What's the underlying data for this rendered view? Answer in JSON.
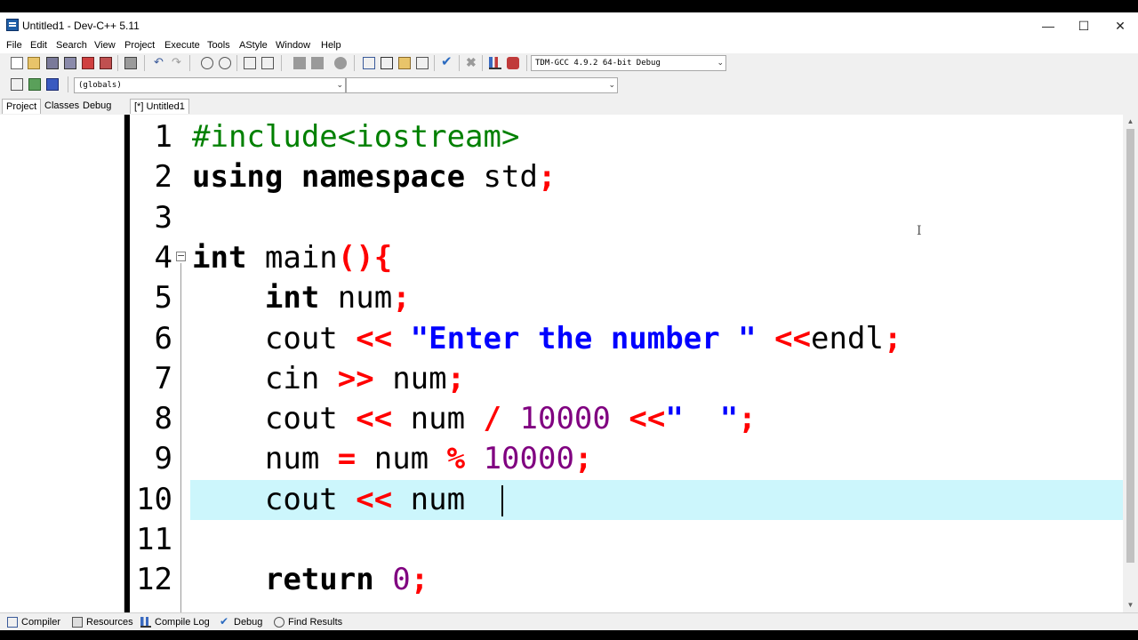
{
  "window": {
    "title": "Untitled1 - Dev-C++ 5.11",
    "minimize": "—",
    "maximize": "☐",
    "close": "✕"
  },
  "menu": [
    "File",
    "Edit",
    "Search",
    "View",
    "Project",
    "Execute",
    "Tools",
    "AStyle",
    "Window",
    "Help"
  ],
  "toolbar": {
    "compiler_select": "TDM-GCC 4.9.2 64-bit Debug",
    "scope_select": "(globals)",
    "symbol_select": ""
  },
  "left_tabs": [
    "Project",
    "Classes",
    "Debug"
  ],
  "editor": {
    "file_tab": "[*] Untitled1",
    "lines": [
      {
        "n": "1",
        "tokens": [
          {
            "t": "#include<iostream>",
            "c": "pre"
          }
        ]
      },
      {
        "n": "2",
        "tokens": [
          {
            "t": "using namespace",
            "c": "kw"
          },
          {
            "t": " std",
            "c": ""
          },
          {
            "t": ";",
            "c": "sym"
          }
        ]
      },
      {
        "n": "3",
        "tokens": []
      },
      {
        "n": "4",
        "tokens": [
          {
            "t": "int",
            "c": "kw"
          },
          {
            "t": " main",
            "c": ""
          },
          {
            "t": "(){",
            "c": "sym"
          }
        ]
      },
      {
        "n": "5",
        "tokens": [
          {
            "t": "    ",
            "c": ""
          },
          {
            "t": "int",
            "c": "kw"
          },
          {
            "t": " num",
            "c": ""
          },
          {
            "t": ";",
            "c": "sym"
          }
        ]
      },
      {
        "n": "6",
        "tokens": [
          {
            "t": "    cout ",
            "c": ""
          },
          {
            "t": "<<",
            "c": "sym"
          },
          {
            "t": " ",
            "c": ""
          },
          {
            "t": "\"Enter the number \"",
            "c": "str"
          },
          {
            "t": " ",
            "c": ""
          },
          {
            "t": "<<",
            "c": "sym"
          },
          {
            "t": "endl",
            "c": ""
          },
          {
            "t": ";",
            "c": "sym"
          }
        ]
      },
      {
        "n": "7",
        "tokens": [
          {
            "t": "    cin ",
            "c": ""
          },
          {
            "t": ">>",
            "c": "sym"
          },
          {
            "t": " num",
            "c": ""
          },
          {
            "t": ";",
            "c": "sym"
          }
        ]
      },
      {
        "n": "8",
        "tokens": [
          {
            "t": "    cout ",
            "c": ""
          },
          {
            "t": "<<",
            "c": "sym"
          },
          {
            "t": " num ",
            "c": ""
          },
          {
            "t": "/",
            "c": "sym"
          },
          {
            "t": " ",
            "c": ""
          },
          {
            "t": "10000",
            "c": "num"
          },
          {
            "t": " ",
            "c": ""
          },
          {
            "t": "<<",
            "c": "sym"
          },
          {
            "t": "\"  \"",
            "c": "str"
          },
          {
            "t": ";",
            "c": "sym"
          }
        ]
      },
      {
        "n": "9",
        "tokens": [
          {
            "t": "    num ",
            "c": ""
          },
          {
            "t": "=",
            "c": "sym"
          },
          {
            "t": " num ",
            "c": ""
          },
          {
            "t": "%",
            "c": "sym"
          },
          {
            "t": " ",
            "c": ""
          },
          {
            "t": "10000",
            "c": "num"
          },
          {
            "t": ";",
            "c": "sym"
          }
        ]
      },
      {
        "n": "10",
        "tokens": [
          {
            "t": "    cout ",
            "c": ""
          },
          {
            "t": "<<",
            "c": "sym"
          },
          {
            "t": " num ",
            "c": ""
          }
        ]
      },
      {
        "n": "11",
        "tokens": []
      },
      {
        "n": "12",
        "tokens": [
          {
            "t": "    ",
            "c": ""
          },
          {
            "t": "return",
            "c": "kw"
          },
          {
            "t": " ",
            "c": ""
          },
          {
            "t": "0",
            "c": "num"
          },
          {
            "t": ";",
            "c": "sym"
          }
        ]
      }
    ]
  },
  "bottom_tabs": [
    "Compiler",
    "Resources",
    "Compile Log",
    "Debug",
    "Find Results"
  ],
  "colors": {
    "current_line": "#ccf6fc",
    "preprocessor": "#008000",
    "symbol": "#ff0000",
    "string": "#0000ff",
    "number": "#800080"
  }
}
